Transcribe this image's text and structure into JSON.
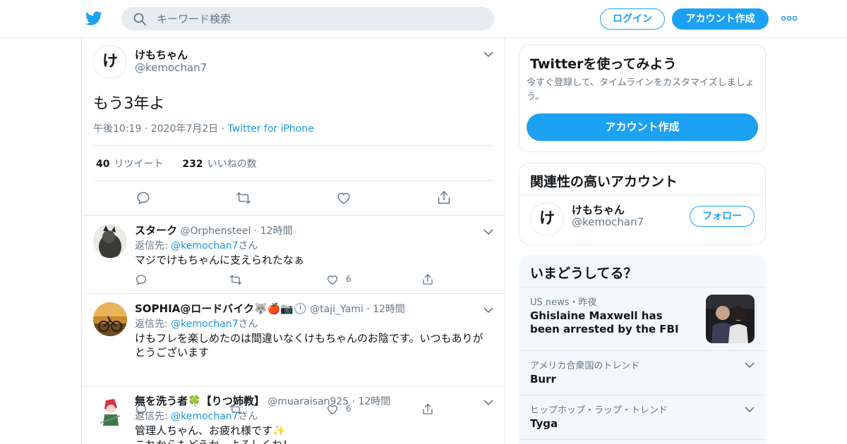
{
  "header": {
    "search_placeholder": "キーワード検索",
    "login_label": "ログイン",
    "signup_label": "アカウント作成"
  },
  "colors": {
    "accent": "#1da1f2",
    "link": "#1b95e0",
    "secondary_text": "#657786",
    "border": "#e1e8ed",
    "trend_bg": "#f5f8fa"
  },
  "icons": {
    "logo": "twitter-bird-icon",
    "search": "search-icon",
    "more": "more-dots-icon",
    "chevron": "chevron-down-icon",
    "reply": "reply-icon",
    "retweet": "retweet-icon",
    "like": "heart-icon",
    "share": "share-icon"
  },
  "tweet": {
    "avatar_char": "け",
    "name": "けもちゃん",
    "handle": "@kemochan7",
    "text": "もう3年よ",
    "time": "午後10:19",
    "date": "2020年7月2日",
    "source": "Twitter for iPhone",
    "retweets": "40",
    "retweets_label": "リツイート",
    "likes": "232",
    "likes_label": "いいねの数"
  },
  "replies": [
    {
      "name": "スターク",
      "handle": "@Orphensteel",
      "time": "12時間",
      "reply_prefix": "返信先: ",
      "mention": "@kemochan7",
      "mention_suffix": "さん",
      "text": "マジでけもちゃんに支えられたなぁ",
      "likes": "6"
    },
    {
      "name": "SOPHIA@ロードバイク🐺🍎📷🕛",
      "handle": "@taji_Yami",
      "time": "12時間",
      "reply_prefix": "返信先: ",
      "mention": "@kemochan7",
      "mention_suffix": "さん",
      "text": "けもフレを楽しめたのは間違いなくけもちゃんのお陰です。いつもありがとうございます",
      "likes": "6"
    },
    {
      "name": "無を洗う者🍀【りつ姉教】",
      "handle": "@muaraisan925",
      "time": "12時間",
      "reply_prefix": "返信先: ",
      "mention": "@kemochan7",
      "mention_suffix": "さん",
      "text": "管理人ちゃん、お疲れ様です✨",
      "text2": "これからもどうか、よろしくね！"
    }
  ],
  "sidebar": {
    "signup_card": {
      "title": "Twitterを使ってみよう",
      "description": "今すぐ登録して、タイムラインをカスタマイズしましょう。",
      "button_label": "アカウント作成"
    },
    "related": {
      "title": "関連性の高いアカウント",
      "avatar_char": "け",
      "name": "けもちゃん",
      "handle": "@kemochan7",
      "follow_label": "フォロー"
    },
    "trends": {
      "title": "いまどうしてる？",
      "items": [
        {
          "meta": "US news・昨夜",
          "name": "Ghislaine Maxwell has been arrested by the FBI"
        },
        {
          "meta": "アメリカ合衆国のトレンド",
          "name": "Burr"
        },
        {
          "meta": "ヒップホップ・ラップ・トレンド",
          "name": "Tyga"
        }
      ]
    }
  }
}
